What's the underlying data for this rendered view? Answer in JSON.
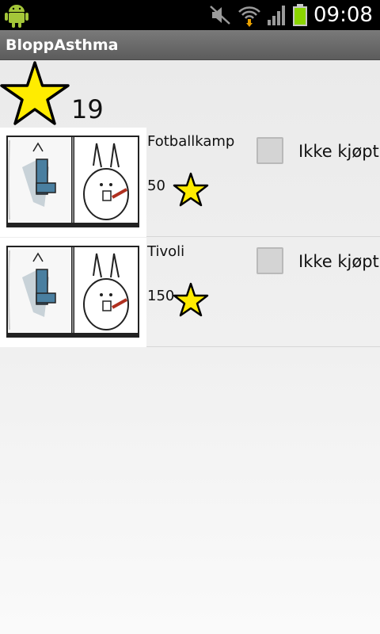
{
  "status_bar": {
    "time": "09:08",
    "icons": [
      "android-icon",
      "mute-icon",
      "wifi-icon",
      "signal-icon",
      "battery-icon"
    ],
    "battery_color": "#8bd400"
  },
  "app": {
    "title": "BloppAsthma"
  },
  "score": {
    "icon": "star-icon",
    "value": "19"
  },
  "colors": {
    "star_fill": "#ffec00",
    "title_bar": "#666666",
    "checkbox": "#d4d4d4"
  },
  "rewards": [
    {
      "name": "Fotballkamp",
      "price": "50",
      "purchased": false,
      "status": "Ikke kjøpt",
      "image_icon": "asthma-book-icon"
    },
    {
      "name": "Tivoli",
      "price": "150",
      "purchased": false,
      "status": "Ikke kjøpt",
      "image_icon": "asthma-book-icon"
    }
  ]
}
